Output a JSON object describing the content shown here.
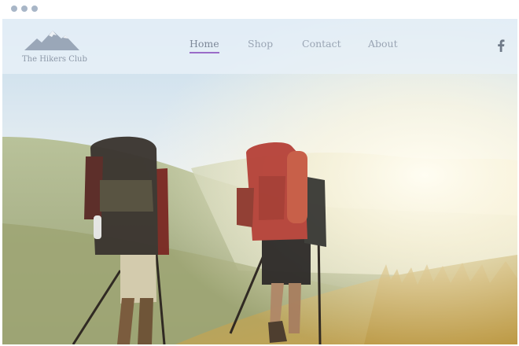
{
  "site": {
    "name": "The Hikers Club"
  },
  "nav": {
    "items": [
      {
        "label": "Home",
        "active": true
      },
      {
        "label": "Shop",
        "active": false
      },
      {
        "label": "Contact",
        "active": false
      },
      {
        "label": "About",
        "active": false
      }
    ],
    "active_color": "#9a6cc8"
  },
  "social": {
    "icon": "facebook-icon"
  }
}
